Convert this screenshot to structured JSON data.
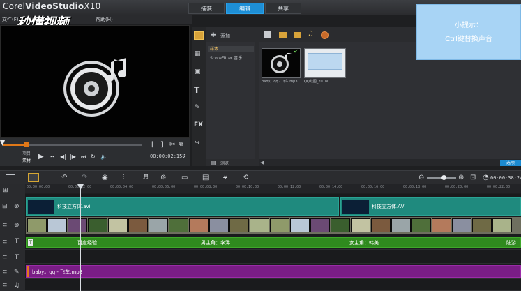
{
  "app": {
    "title_main": "Corel",
    "title_bold": "VideoStudio",
    "title_version": "X10"
  },
  "tabs": [
    {
      "label": "捕获",
      "active": false
    },
    {
      "label": "编辑",
      "active": true
    },
    {
      "label": "共享",
      "active": false
    }
  ],
  "menu": {
    "file": "文件(F)",
    "tools": "工具(T)",
    "help": "帮助(H)"
  },
  "watermark": "秒懂视频",
  "player": {
    "mode_project": "项目",
    "mode_clip": "素材",
    "timecode": "00:00:02:15",
    "bracket_in": "[",
    "bracket_out": "]"
  },
  "library": {
    "add_label": "添加",
    "items": [
      {
        "label": "样本",
        "selected": true
      },
      {
        "label": "ScoreFitter 音乐",
        "selected": false
      }
    ],
    "browse_label": "浏览",
    "options_label": "选项",
    "thumbs": [
      {
        "caption": "baby。qq - 飞车.mp3"
      },
      {
        "caption": "QQ截图_20180..."
      }
    ]
  },
  "tip": {
    "title": "小提示：",
    "body": "Ctrl键替换声音"
  },
  "timeline": {
    "total_time": "00:00:38:24",
    "ruler_labels": [
      "00:00:00:00",
      "00:00:02:00",
      "00:00:04:00",
      "00:00:06:00",
      "00:00:08:00",
      "00:00:10:00",
      "00:00:12:00",
      "00:00:14:00",
      "00:00:16:00",
      "00:00:18:00",
      "00:00:20:00",
      "00:00:22:00"
    ],
    "overlay_clips": [
      "科技立方体.avi",
      "科技立方体.AVI"
    ],
    "title_track": {
      "marker": "T",
      "labels": [
        "百度经验",
        "男主角：李沸",
        "女主角：韩美",
        "陆游"
      ]
    },
    "music_clip": "baby。qq - 飞车.mp3"
  },
  "colors": {
    "accent": "#1e8fd6",
    "tip_bg": "#a8d4f5",
    "overlay_clip": "#1f8a7e",
    "title_clip": "#2f8a1e",
    "music_clip": "#7a1d86",
    "scrub_progress": "#e07818"
  }
}
